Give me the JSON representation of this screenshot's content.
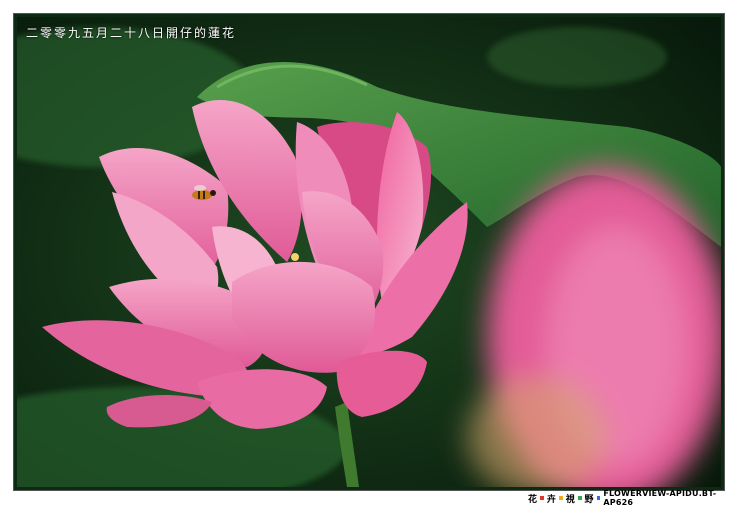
{
  "caption": "二零零九五月二十八日開仔的蓮花",
  "credit": {
    "chars": [
      "花",
      "卉",
      "視",
      "野"
    ],
    "text": "FLOWERVIEW-APIDU.BT-AP626",
    "dot_colors": [
      "#e8322a",
      "#f2a81b",
      "#33a852",
      "#2f6fd8"
    ]
  },
  "colors": {
    "background": "#0d2a12",
    "leaf": "#3d8a3b",
    "petal": "#ec6fa8",
    "petal_light": "#f6a9cc"
  }
}
